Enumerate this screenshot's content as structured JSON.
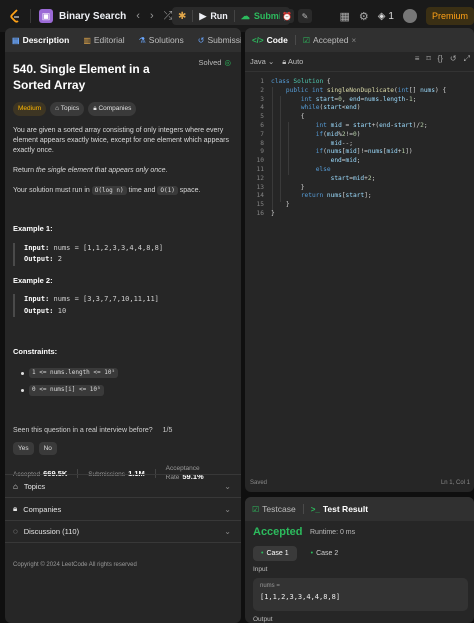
{
  "topbar": {
    "problem_list_label": "Binary Search",
    "run_label": "Run",
    "submit_label": "Submit",
    "streak_count": "1",
    "premium_label": "Premium"
  },
  "left_tabs": [
    {
      "label": "Description"
    },
    {
      "label": "Editorial"
    },
    {
      "label": "Solutions"
    },
    {
      "label": "Submissions"
    }
  ],
  "problem": {
    "title": "540. Single Element in a Sorted Array",
    "solved_label": "Solved",
    "difficulty": "Medium",
    "topics_label": "Topics",
    "companies_label": "Companies",
    "desc1": "You are given a sorted array consisting of only integers where every element appears exactly twice, except for one element which appears exactly once.",
    "desc2_pre": "Return ",
    "desc2_em": "the single element that appears only once",
    "desc2_post": ".",
    "desc3_pre": "Your solution must run in ",
    "desc3_code1": "O(log n)",
    "desc3_mid": " time and ",
    "desc3_code2": "O(1)",
    "desc3_post": " space.",
    "examples": [
      {
        "title": "Example 1:",
        "input_label": "Input:",
        "input": "nums = [1,1,2,3,3,4,4,8,8]",
        "output_label": "Output:",
        "output": "2"
      },
      {
        "title": "Example 2:",
        "input_label": "Input:",
        "input": "nums = [3,3,7,7,10,11,11]",
        "output_label": "Output:",
        "output": "10"
      }
    ],
    "constraints_title": "Constraints:",
    "constraints": [
      "1 <= nums.length <= 10⁵",
      "0 <= nums[i] <= 10⁵"
    ]
  },
  "interview": {
    "question": "Seen this question in a real interview before?",
    "fraction": "1/5",
    "yes": "Yes",
    "no": "No",
    "accepted_label": "Accepted",
    "accepted_value": "669.5K",
    "submissions_label": "Submissions",
    "submissions_value": "1.1M",
    "rate_label": "Acceptance Rate",
    "rate_value": "59.1%"
  },
  "accordions": [
    {
      "label": "Topics"
    },
    {
      "label": "Companies"
    },
    {
      "label": "Discussion (110)"
    }
  ],
  "copyright": "Copyright © 2024 LeetCode All rights reserved",
  "code_tabs": [
    {
      "label": "Code"
    },
    {
      "label": "Accepted"
    }
  ],
  "editor": {
    "language": "Java",
    "mode": "Auto",
    "saved_label": "Saved",
    "cursor": "Ln 1, Col 1",
    "line_numbers": [
      "1",
      "2",
      "3",
      "4",
      "5",
      "6",
      "7",
      "8",
      "9",
      "10",
      "11",
      "12",
      "13",
      "14",
      "15",
      "16"
    ]
  },
  "result_tabs": [
    {
      "label": "Testcase"
    },
    {
      "label": "Test Result"
    }
  ],
  "result": {
    "status": "Accepted",
    "runtime": "Runtime: 0 ms",
    "cases": [
      "Case 1",
      "Case 2"
    ],
    "input_label": "Input",
    "input_name": "nums =",
    "input_value": "[1,1,2,3,3,4,4,8,8]",
    "output_label": "Output"
  },
  "icons": {
    "logo": "leetcode-logo",
    "accent_orange": "#ffa116",
    "accent_green": "#2cbb5d"
  }
}
